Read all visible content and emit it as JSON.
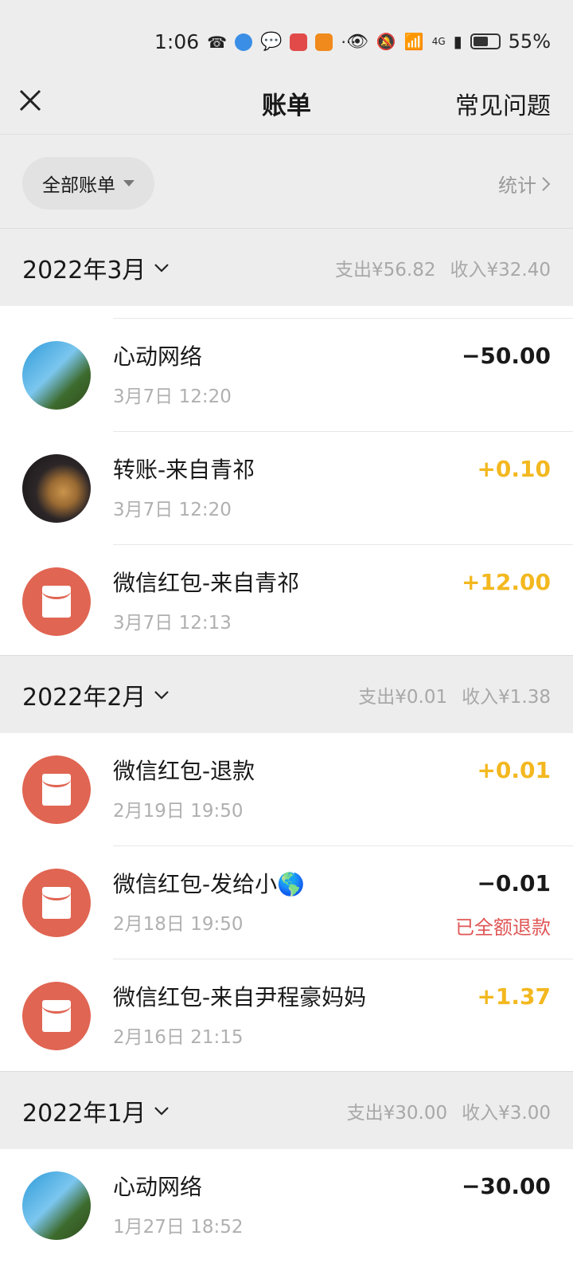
{
  "status_bar": {
    "time": "1:06",
    "battery": "55%",
    "network": "4G",
    "more": "···"
  },
  "nav": {
    "title": "账单",
    "help": "常见问题"
  },
  "filter": {
    "label": "全部账单",
    "stats": "统计"
  },
  "months": [
    {
      "title": "2022年3月",
      "expense": "支出¥56.82",
      "income": "收入¥32.40",
      "transactions": [
        {
          "name": "心动网络",
          "time": "3月7日 12:20",
          "amount": "−50.00",
          "type": "expense",
          "avatar": "game-avatar"
        },
        {
          "name": "转账-来自青祁",
          "time": "3月7日 12:20",
          "amount": "+0.10",
          "type": "income",
          "avatar": "dog-avatar"
        },
        {
          "name": "微信红包-来自青祁",
          "time": "3月7日 12:13",
          "amount": "+12.00",
          "type": "income",
          "avatar": "red-envelope-icon"
        }
      ]
    },
    {
      "title": "2022年2月",
      "expense": "支出¥0.01",
      "income": "收入¥1.38",
      "transactions": [
        {
          "name": "微信红包-退款",
          "time": "2月19日 19:50",
          "amount": "+0.01",
          "type": "income",
          "avatar": "red-envelope-icon"
        },
        {
          "name": "微信红包-发给小🌎",
          "time": "2月18日 19:50",
          "amount": "−0.01",
          "type": "expense",
          "note": "已全额退款",
          "avatar": "red-envelope-icon"
        },
        {
          "name": "微信红包-来自尹程豪妈妈",
          "time": "2月16日 21:15",
          "amount": "+1.37",
          "type": "income",
          "avatar": "red-envelope-icon"
        }
      ]
    },
    {
      "title": "2022年1月",
      "expense": "支出¥30.00",
      "income": "收入¥3.00",
      "transactions": [
        {
          "name": "心动网络",
          "time": "1月27日 18:52",
          "amount": "−30.00",
          "type": "expense",
          "avatar": "game-avatar"
        }
      ]
    }
  ],
  "colors": {
    "income": "#f3b81f",
    "refund_note": "#e05656",
    "red_envelope": "#e06552",
    "background": "#ededed"
  }
}
